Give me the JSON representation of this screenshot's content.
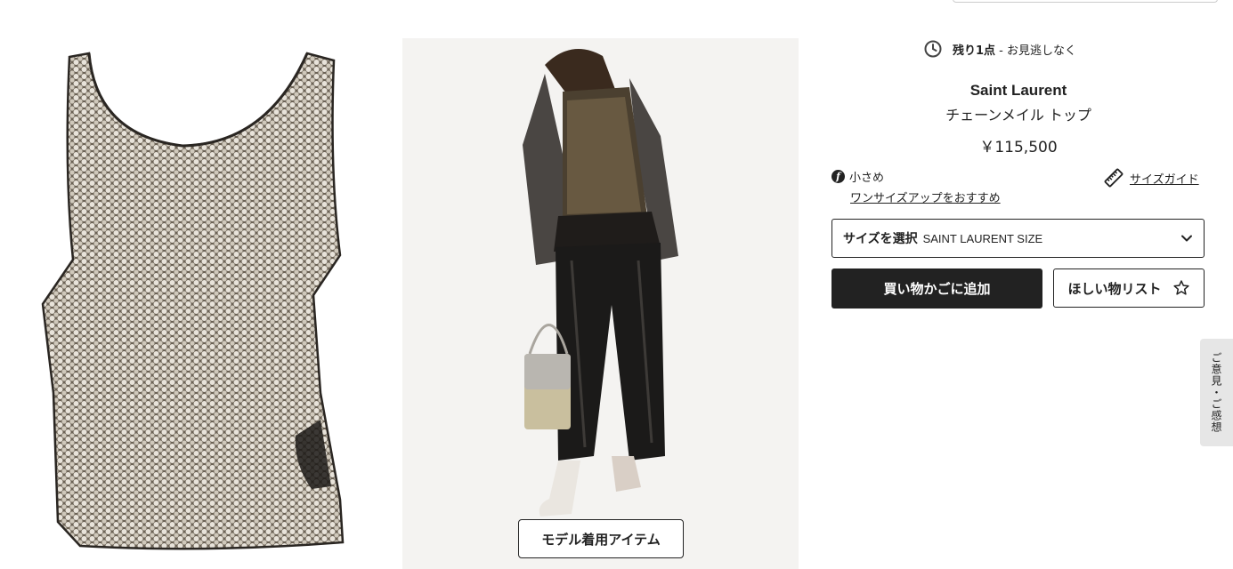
{
  "stock": {
    "bold": "残り1点",
    "rest": " - お見逃しなく"
  },
  "product": {
    "brand": "Saint Laurent",
    "name": "チェーンメイル トップ",
    "price": "￥115,500"
  },
  "fit": {
    "label": "小さめ",
    "recommendation": "ワンサイズアップをおすすめ",
    "size_guide": "サイズガイド"
  },
  "size_select": {
    "label": "サイズを選択",
    "value": "SAINT LAURENT SIZE"
  },
  "buttons": {
    "add_to_cart": "買い物かごに追加",
    "wishlist": "ほしい物リスト",
    "model_item": "モデル着用アイテム"
  },
  "feedback": {
    "label": "ご意見・ご感想"
  },
  "icons": {
    "clock": "clock-icon",
    "fit": "fit-info-icon",
    "size_guide": "ruler-icon",
    "select": "chevron-down-icon",
    "wishlist": "star-icon"
  },
  "colors": {
    "primary": "#222222",
    "background": "#ffffff",
    "feedback_tab": "#e6e6e6",
    "image_bg": "#f4f3f1"
  }
}
